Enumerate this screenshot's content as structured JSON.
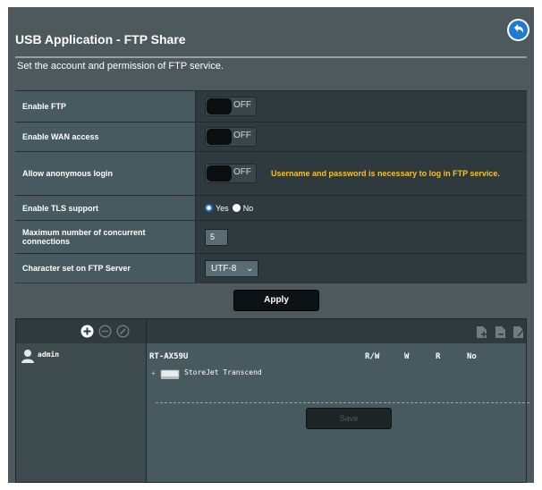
{
  "header": {
    "title": "USB Application - FTP Share"
  },
  "description": "Set the account and permission of FTP service.",
  "settings": {
    "enable_ftp": {
      "label": "Enable FTP",
      "state": "OFF"
    },
    "enable_wan": {
      "label": "Enable WAN access",
      "state": "OFF"
    },
    "anonymous": {
      "label": "Allow anonymous login",
      "state": "OFF",
      "note": "Username and password is necessary to log in FTP service."
    },
    "tls": {
      "label": "Enable TLS support",
      "yes": "Yes",
      "no": "No",
      "selected": "Yes"
    },
    "max_conn": {
      "label": "Maximum number of concurrent connections",
      "value": "5"
    },
    "charset": {
      "label": "Character set on FTP Server",
      "value": "UTF-8"
    }
  },
  "apply_label": "Apply",
  "accounts": {
    "users": [
      "admin"
    ]
  },
  "permissions": {
    "device": "RT-AX59U",
    "columns": [
      "R/W",
      "W",
      "R",
      "No"
    ],
    "folders": [
      "StoreJet Transcend"
    ],
    "save_label": "Save"
  },
  "colors": {
    "background": "#4d595d",
    "panel": "#2f3a3e",
    "warning": "#f2c12e",
    "radio_accent": "#1a78d6"
  },
  "icons": [
    "back-arrow-icon",
    "add-user-icon",
    "remove-user-icon",
    "edit-user-icon",
    "add-folder-icon",
    "delete-folder-icon",
    "rename-folder-icon",
    "user-icon",
    "disk-icon"
  ]
}
